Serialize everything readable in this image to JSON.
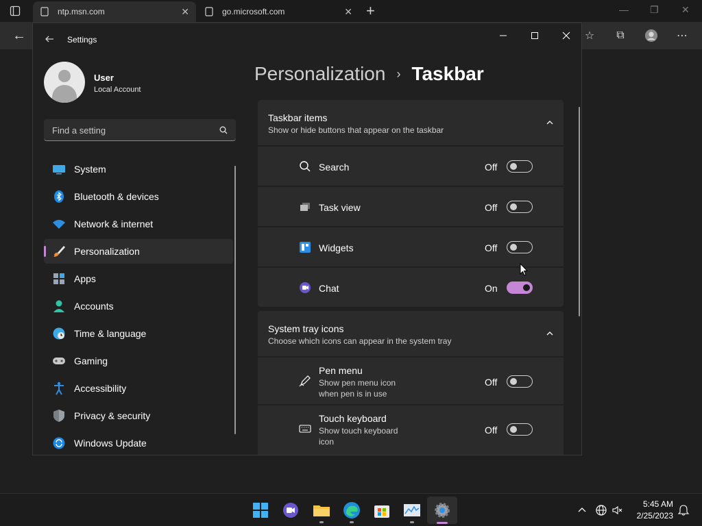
{
  "browser": {
    "tabs": [
      {
        "title": "ntp.msn.com",
        "active": true
      },
      {
        "title": "go.microsoft.com",
        "active": false
      }
    ]
  },
  "settings": {
    "window_title": "Settings",
    "user": {
      "name": "User",
      "account": "Local Account"
    },
    "search_placeholder": "Find a setting",
    "nav": [
      {
        "label": "System",
        "icon": "monitor-icon"
      },
      {
        "label": "Bluetooth & devices",
        "icon": "bluetooth-icon"
      },
      {
        "label": "Network & internet",
        "icon": "wifi-icon"
      },
      {
        "label": "Personalization",
        "icon": "brush-icon",
        "active": true
      },
      {
        "label": "Apps",
        "icon": "apps-icon"
      },
      {
        "label": "Accounts",
        "icon": "person-icon"
      },
      {
        "label": "Time & language",
        "icon": "globe-clock-icon"
      },
      {
        "label": "Gaming",
        "icon": "gamepad-icon"
      },
      {
        "label": "Accessibility",
        "icon": "accessibility-icon"
      },
      {
        "label": "Privacy & security",
        "icon": "shield-icon"
      },
      {
        "label": "Windows Update",
        "icon": "update-icon"
      }
    ],
    "breadcrumb": {
      "parent": "Personalization",
      "separator": "›",
      "current": "Taskbar"
    },
    "taskbar_items": {
      "title": "Taskbar items",
      "subtitle": "Show or hide buttons that appear on the taskbar",
      "rows": [
        {
          "label": "Search",
          "state": "Off",
          "on": false,
          "icon": "search-icon"
        },
        {
          "label": "Task view",
          "state": "Off",
          "on": false,
          "icon": "task-view-icon"
        },
        {
          "label": "Widgets",
          "state": "Off",
          "on": false,
          "icon": "widgets-icon"
        },
        {
          "label": "Chat",
          "state": "On",
          "on": true,
          "icon": "chat-icon"
        }
      ]
    },
    "system_tray": {
      "title": "System tray icons",
      "subtitle": "Choose which icons can appear in the system tray",
      "rows": [
        {
          "label": "Pen menu",
          "sub1": "Show pen menu icon",
          "sub2": "when pen is in use",
          "state": "Off",
          "on": false,
          "icon": "pen-icon"
        },
        {
          "label": "Touch keyboard",
          "sub1": "Show touch keyboard",
          "sub2": "icon",
          "state": "Off",
          "on": false,
          "icon": "keyboard-icon"
        }
      ]
    },
    "accent_color": "#c586d6"
  },
  "taskbar": {
    "time": "5:45 AM",
    "date": "2/25/2023"
  }
}
